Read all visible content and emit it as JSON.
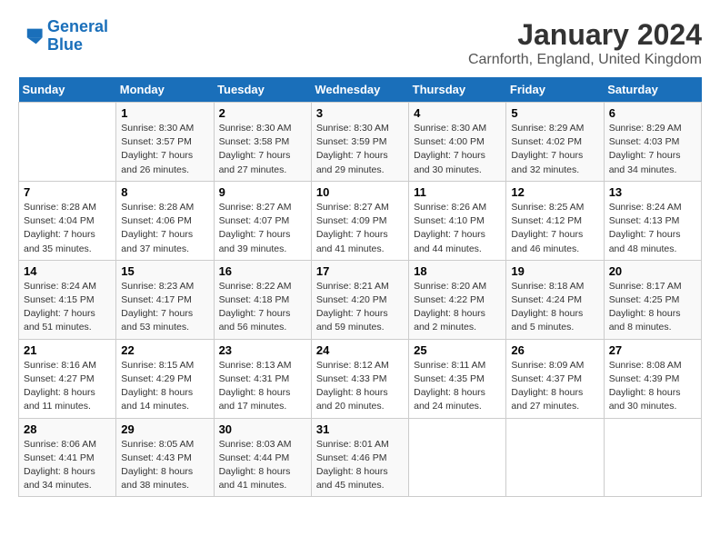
{
  "header": {
    "logo_line1": "General",
    "logo_line2": "Blue",
    "title": "January 2024",
    "subtitle": "Carnforth, England, United Kingdom"
  },
  "calendar": {
    "days_of_week": [
      "Sunday",
      "Monday",
      "Tuesday",
      "Wednesday",
      "Thursday",
      "Friday",
      "Saturday"
    ],
    "weeks": [
      [
        {
          "day": "",
          "sunrise": "",
          "sunset": "",
          "daylight": ""
        },
        {
          "day": "1",
          "sunrise": "Sunrise: 8:30 AM",
          "sunset": "Sunset: 3:57 PM",
          "daylight": "Daylight: 7 hours and 26 minutes."
        },
        {
          "day": "2",
          "sunrise": "Sunrise: 8:30 AM",
          "sunset": "Sunset: 3:58 PM",
          "daylight": "Daylight: 7 hours and 27 minutes."
        },
        {
          "day": "3",
          "sunrise": "Sunrise: 8:30 AM",
          "sunset": "Sunset: 3:59 PM",
          "daylight": "Daylight: 7 hours and 29 minutes."
        },
        {
          "day": "4",
          "sunrise": "Sunrise: 8:30 AM",
          "sunset": "Sunset: 4:00 PM",
          "daylight": "Daylight: 7 hours and 30 minutes."
        },
        {
          "day": "5",
          "sunrise": "Sunrise: 8:29 AM",
          "sunset": "Sunset: 4:02 PM",
          "daylight": "Daylight: 7 hours and 32 minutes."
        },
        {
          "day": "6",
          "sunrise": "Sunrise: 8:29 AM",
          "sunset": "Sunset: 4:03 PM",
          "daylight": "Daylight: 7 hours and 34 minutes."
        }
      ],
      [
        {
          "day": "7",
          "sunrise": "Sunrise: 8:28 AM",
          "sunset": "Sunset: 4:04 PM",
          "daylight": "Daylight: 7 hours and 35 minutes."
        },
        {
          "day": "8",
          "sunrise": "Sunrise: 8:28 AM",
          "sunset": "Sunset: 4:06 PM",
          "daylight": "Daylight: 7 hours and 37 minutes."
        },
        {
          "day": "9",
          "sunrise": "Sunrise: 8:27 AM",
          "sunset": "Sunset: 4:07 PM",
          "daylight": "Daylight: 7 hours and 39 minutes."
        },
        {
          "day": "10",
          "sunrise": "Sunrise: 8:27 AM",
          "sunset": "Sunset: 4:09 PM",
          "daylight": "Daylight: 7 hours and 41 minutes."
        },
        {
          "day": "11",
          "sunrise": "Sunrise: 8:26 AM",
          "sunset": "Sunset: 4:10 PM",
          "daylight": "Daylight: 7 hours and 44 minutes."
        },
        {
          "day": "12",
          "sunrise": "Sunrise: 8:25 AM",
          "sunset": "Sunset: 4:12 PM",
          "daylight": "Daylight: 7 hours and 46 minutes."
        },
        {
          "day": "13",
          "sunrise": "Sunrise: 8:24 AM",
          "sunset": "Sunset: 4:13 PM",
          "daylight": "Daylight: 7 hours and 48 minutes."
        }
      ],
      [
        {
          "day": "14",
          "sunrise": "Sunrise: 8:24 AM",
          "sunset": "Sunset: 4:15 PM",
          "daylight": "Daylight: 7 hours and 51 minutes."
        },
        {
          "day": "15",
          "sunrise": "Sunrise: 8:23 AM",
          "sunset": "Sunset: 4:17 PM",
          "daylight": "Daylight: 7 hours and 53 minutes."
        },
        {
          "day": "16",
          "sunrise": "Sunrise: 8:22 AM",
          "sunset": "Sunset: 4:18 PM",
          "daylight": "Daylight: 7 hours and 56 minutes."
        },
        {
          "day": "17",
          "sunrise": "Sunrise: 8:21 AM",
          "sunset": "Sunset: 4:20 PM",
          "daylight": "Daylight: 7 hours and 59 minutes."
        },
        {
          "day": "18",
          "sunrise": "Sunrise: 8:20 AM",
          "sunset": "Sunset: 4:22 PM",
          "daylight": "Daylight: 8 hours and 2 minutes."
        },
        {
          "day": "19",
          "sunrise": "Sunrise: 8:18 AM",
          "sunset": "Sunset: 4:24 PM",
          "daylight": "Daylight: 8 hours and 5 minutes."
        },
        {
          "day": "20",
          "sunrise": "Sunrise: 8:17 AM",
          "sunset": "Sunset: 4:25 PM",
          "daylight": "Daylight: 8 hours and 8 minutes."
        }
      ],
      [
        {
          "day": "21",
          "sunrise": "Sunrise: 8:16 AM",
          "sunset": "Sunset: 4:27 PM",
          "daylight": "Daylight: 8 hours and 11 minutes."
        },
        {
          "day": "22",
          "sunrise": "Sunrise: 8:15 AM",
          "sunset": "Sunset: 4:29 PM",
          "daylight": "Daylight: 8 hours and 14 minutes."
        },
        {
          "day": "23",
          "sunrise": "Sunrise: 8:13 AM",
          "sunset": "Sunset: 4:31 PM",
          "daylight": "Daylight: 8 hours and 17 minutes."
        },
        {
          "day": "24",
          "sunrise": "Sunrise: 8:12 AM",
          "sunset": "Sunset: 4:33 PM",
          "daylight": "Daylight: 8 hours and 20 minutes."
        },
        {
          "day": "25",
          "sunrise": "Sunrise: 8:11 AM",
          "sunset": "Sunset: 4:35 PM",
          "daylight": "Daylight: 8 hours and 24 minutes."
        },
        {
          "day": "26",
          "sunrise": "Sunrise: 8:09 AM",
          "sunset": "Sunset: 4:37 PM",
          "daylight": "Daylight: 8 hours and 27 minutes."
        },
        {
          "day": "27",
          "sunrise": "Sunrise: 8:08 AM",
          "sunset": "Sunset: 4:39 PM",
          "daylight": "Daylight: 8 hours and 30 minutes."
        }
      ],
      [
        {
          "day": "28",
          "sunrise": "Sunrise: 8:06 AM",
          "sunset": "Sunset: 4:41 PM",
          "daylight": "Daylight: 8 hours and 34 minutes."
        },
        {
          "day": "29",
          "sunrise": "Sunrise: 8:05 AM",
          "sunset": "Sunset: 4:43 PM",
          "daylight": "Daylight: 8 hours and 38 minutes."
        },
        {
          "day": "30",
          "sunrise": "Sunrise: 8:03 AM",
          "sunset": "Sunset: 4:44 PM",
          "daylight": "Daylight: 8 hours and 41 minutes."
        },
        {
          "day": "31",
          "sunrise": "Sunrise: 8:01 AM",
          "sunset": "Sunset: 4:46 PM",
          "daylight": "Daylight: 8 hours and 45 minutes."
        },
        {
          "day": "",
          "sunrise": "",
          "sunset": "",
          "daylight": ""
        },
        {
          "day": "",
          "sunrise": "",
          "sunset": "",
          "daylight": ""
        },
        {
          "day": "",
          "sunrise": "",
          "sunset": "",
          "daylight": ""
        }
      ]
    ]
  }
}
